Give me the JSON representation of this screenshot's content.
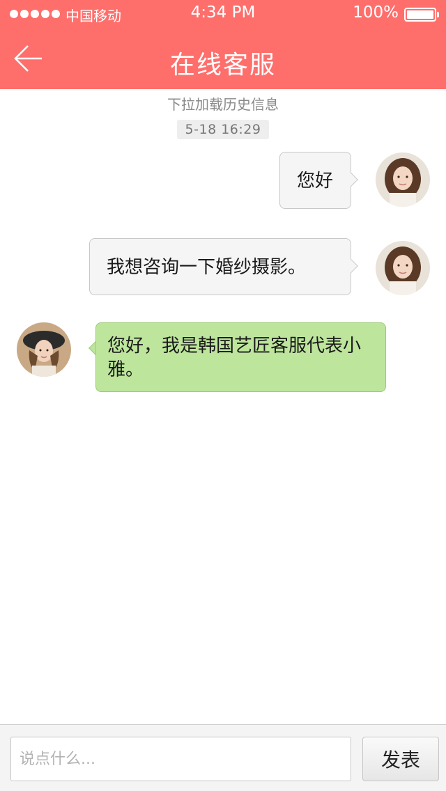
{
  "status_bar": {
    "carrier": "中国移动",
    "time": "4:34 PM",
    "battery": "100%"
  },
  "header": {
    "title": "在线客服",
    "back_icon": "back-arrow-icon"
  },
  "chat": {
    "pull_hint": "下拉加载历史信息",
    "timestamp": "5-18  16:29",
    "messages": [
      {
        "side": "out",
        "text": "您好"
      },
      {
        "side": "out",
        "text": "我想咨询一下婚纱摄影。"
      },
      {
        "side": "in",
        "text": "您好，我是韩国艺匠客服代表小雅。"
      }
    ]
  },
  "composer": {
    "placeholder": "说点什么...",
    "value": "",
    "send_label": "发表"
  },
  "colors": {
    "header_bg": "#fe6f6c",
    "incoming_bubble": "#bde59c",
    "outgoing_bubble": "#f5f5f5"
  }
}
